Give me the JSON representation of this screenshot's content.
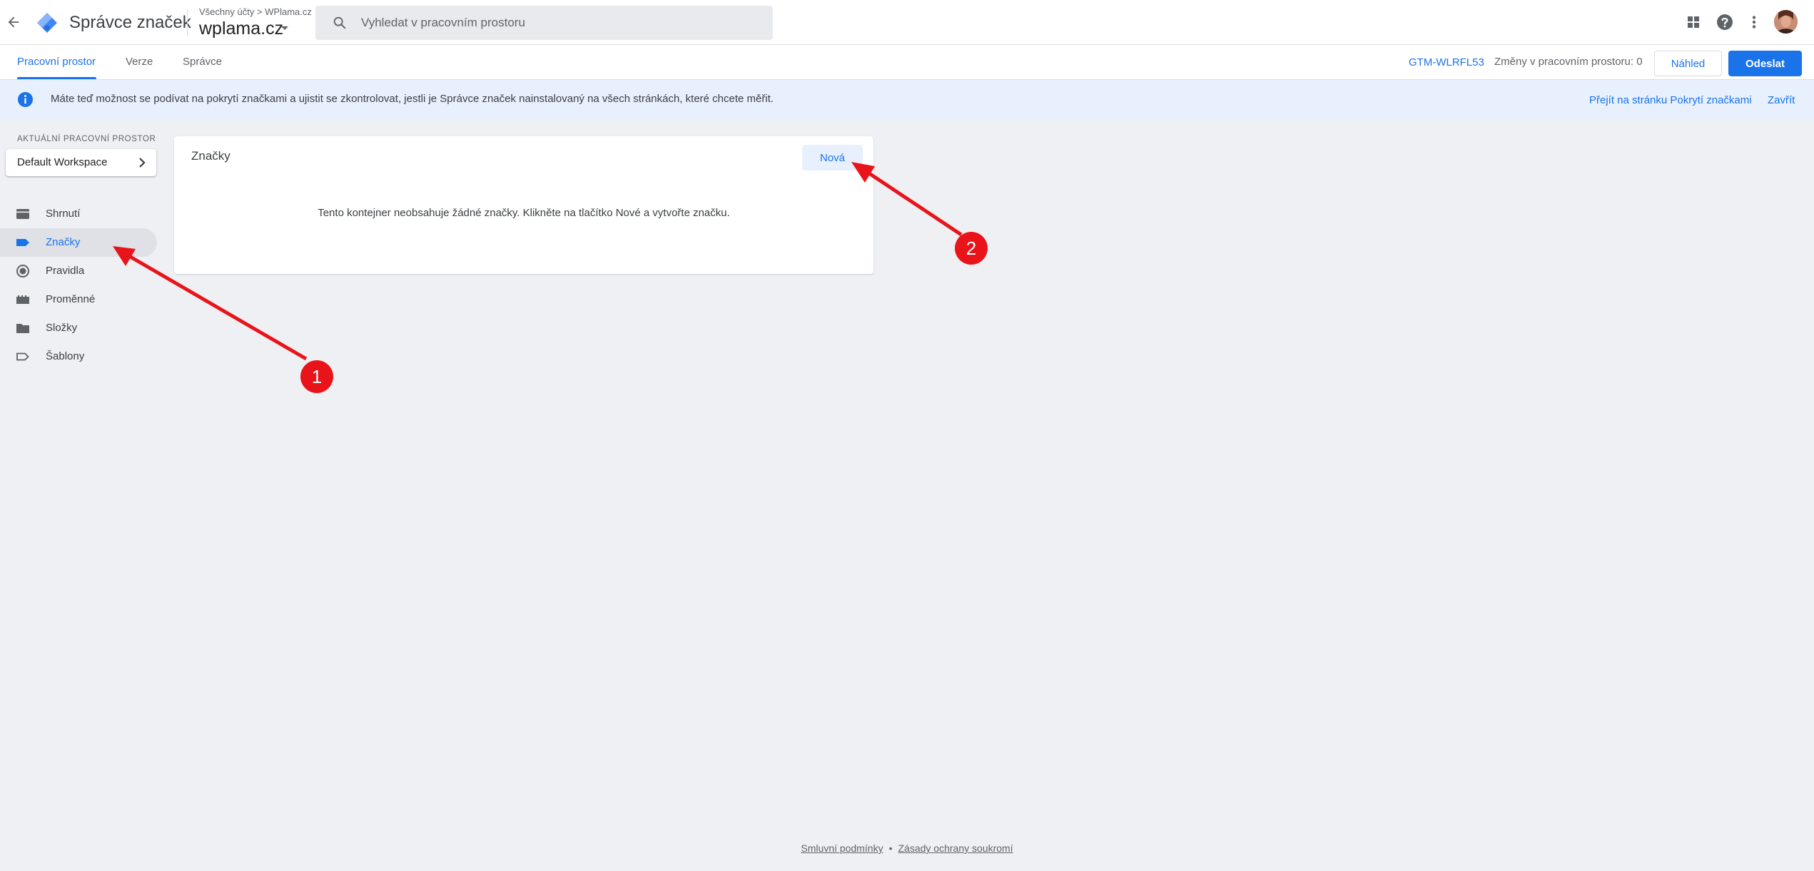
{
  "header": {
    "app_title": "Správce značek",
    "breadcrumb": "Všechny účty > WPlama.cz",
    "container_name": "wplama.cz",
    "search_placeholder": "Vyhledat v pracovním prostoru",
    "icons": [
      "arrow-back-icon",
      "gtm-logo",
      "search-icon",
      "apps-icon",
      "help-icon",
      "more-vert-icon"
    ]
  },
  "tabs": [
    {
      "label": "Pracovní prostor",
      "active": true
    },
    {
      "label": "Verze",
      "active": false
    },
    {
      "label": "Správce",
      "active": false
    }
  ],
  "toolbar": {
    "container_id": "GTM-WLRFL53",
    "changes_text": "Změny v pracovním prostoru: 0",
    "preview_label": "Náhled",
    "submit_label": "Odeslat"
  },
  "banner": {
    "text": "Máte teď možnost se podívat na pokrytí značkami a ujistit se zkontrolovat, jestli je Správce značek nainstalovaný na všech stránkách, které chcete měřit.",
    "link_label": "Přejít na stránku Pokrytí značkami",
    "close_label": "Zavřít"
  },
  "sidebar": {
    "workspace_label": "AKTUÁLNÍ PRACOVNÍ PROSTOR",
    "workspace_name": "Default Workspace",
    "items": [
      {
        "label": "Shrnutí",
        "icon": "summary-icon",
        "active": false
      },
      {
        "label": "Značky",
        "icon": "tag-icon",
        "active": true
      },
      {
        "label": "Pravidla",
        "icon": "trigger-icon",
        "active": false
      },
      {
        "label": "Proměnné",
        "icon": "variable-icon",
        "active": false
      },
      {
        "label": "Složky",
        "icon": "folder-icon",
        "active": false
      },
      {
        "label": "Šablony",
        "icon": "template-icon",
        "active": false
      }
    ]
  },
  "main": {
    "card_title": "Značky",
    "new_button_label": "Nová",
    "empty_message": "Tento kontejner neobsahuje žádné značky. Klikněte na tlačítko Nové a vytvořte značku."
  },
  "annotations": {
    "markers": [
      "1",
      "2"
    ],
    "color": "#e8141a"
  },
  "footer": {
    "terms": "Smluvní podmínky",
    "separator": "•",
    "privacy": "Zásady ochrany soukromí"
  },
  "colors": {
    "accent": "#1a73e8",
    "background": "#eff0f3",
    "banner": "#e8f0fe"
  }
}
